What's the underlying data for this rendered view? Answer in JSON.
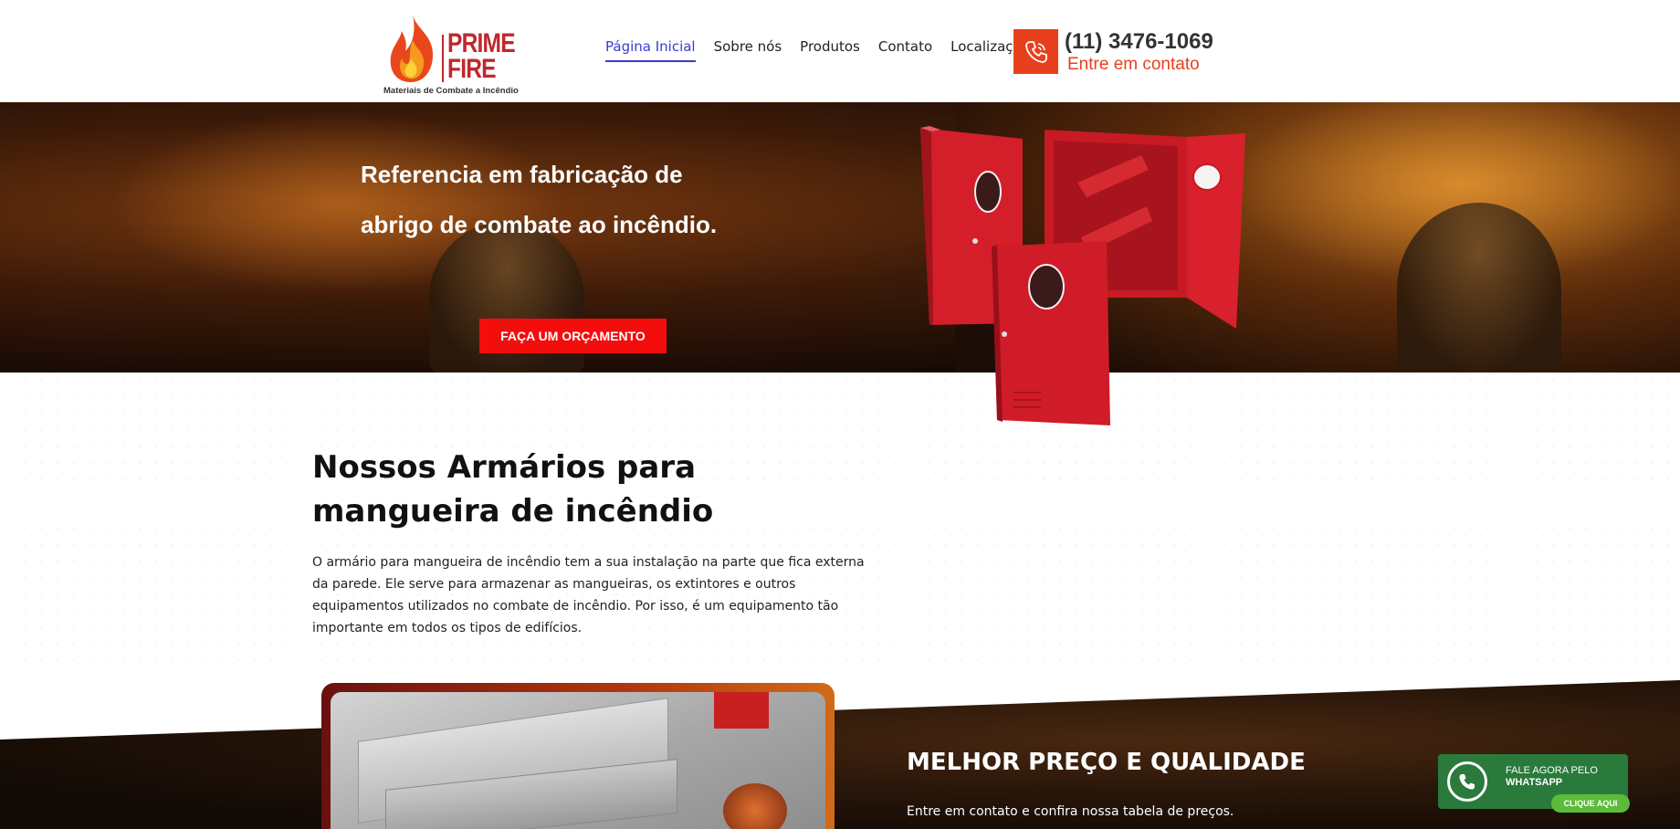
{
  "logo": {
    "line1": "PRIME",
    "line2": "FIRE",
    "tagline": "Materiais de Combate a Incêndio"
  },
  "nav": {
    "items": [
      {
        "label": "Página Inicial",
        "active": true
      },
      {
        "label": "Sobre nós",
        "active": false
      },
      {
        "label": "Produtos",
        "active": false
      },
      {
        "label": "Contato",
        "active": false
      },
      {
        "label": "Localização",
        "active": false
      }
    ]
  },
  "contact": {
    "icon": "phone-icon",
    "phone": "(11) 3476-1069",
    "cta": "Entre em contato",
    "accent_color": "#e8401c"
  },
  "hero": {
    "title_line1": "Referencia em fabricação de",
    "title_line2": "abrigo de combate ao incêndio.",
    "button_label": "FAÇA UM ORÇAMENTO",
    "button_color": "#f40d0d"
  },
  "section": {
    "title_line1": "Nossos Armários para",
    "title_line2": "mangueira de incêndio",
    "text": "O armário para mangueira de incêndio tem a sua instalação na parte que fica externa da parede. Ele serve para armazenar as mangueiras, os extintores e outros equipamentos utilizados no combate de incêndio. Por isso, é um equipamento tão importante em todos os tipos de edifícios."
  },
  "bottom": {
    "title": "MELHOR PREÇO E QUALIDADE",
    "text": "Entre em contato e confira nossa tabela de preços."
  },
  "whatsapp": {
    "icon": "whatsapp-icon",
    "line1": "FALE AGORA PELO",
    "line2": "WHATSAPP",
    "button": "CLIQUE AQUI",
    "color": "#2a7a3c"
  }
}
